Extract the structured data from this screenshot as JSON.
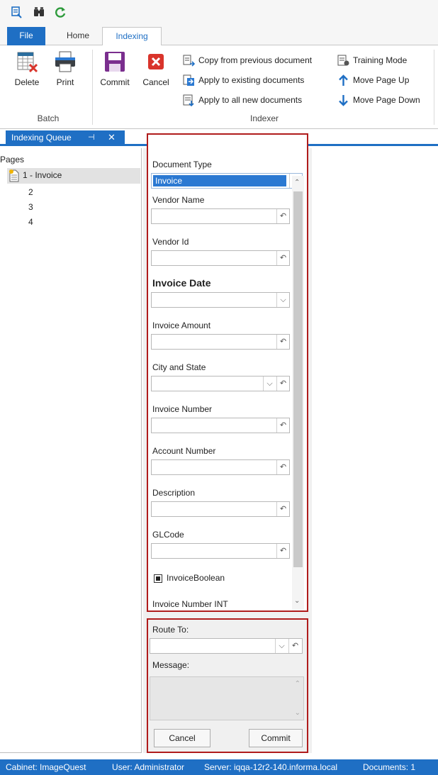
{
  "quick_access": {
    "icons": [
      "scan-icon",
      "binoculars-icon",
      "refresh-icon"
    ]
  },
  "tabs": {
    "file": "File",
    "home": "Home",
    "indexing": "Indexing"
  },
  "ribbon": {
    "batch": {
      "delete": "Delete",
      "print": "Print",
      "group_label": "Batch"
    },
    "indexer": {
      "commit": "Commit",
      "cancel": "Cancel",
      "copy_prev": "Copy from previous document",
      "apply_existing": "Apply to existing documents",
      "apply_new": "Apply to all new documents",
      "training_mode": "Training Mode",
      "move_up": "Move Page Up",
      "move_down": "Move Page Down",
      "group_label": "Indexer"
    }
  },
  "dock": {
    "tab_label": "Indexing Queue",
    "pin_glyph": "⊣",
    "close_glyph": "✕"
  },
  "pages": {
    "header": "Pages",
    "items": [
      "1 - Invoice",
      "2",
      "3",
      "4"
    ]
  },
  "index_form": {
    "document_type_label": "Document Type",
    "document_type_value": "Invoice",
    "fields": {
      "vendor_name": "Vendor Name",
      "vendor_id": "Vendor Id",
      "invoice_date": "Invoice Date",
      "invoice_amount": "Invoice Amount",
      "city_state": "City and State",
      "invoice_number": "Invoice Number",
      "account_number": "Account Number",
      "description": "Description",
      "glcode": "GLCode",
      "invoice_boolean": "InvoiceBoolean",
      "invoice_number_int": "Invoice Number INT"
    },
    "reset_glyph": "↶",
    "dropdown_glyph": "⌵"
  },
  "route": {
    "route_to_label": "Route To:",
    "message_label": "Message:",
    "cancel": "Cancel",
    "commit": "Commit"
  },
  "status": {
    "cabinet": "Cabinet: ImageQuest",
    "user": "User: Administrator",
    "server": "Server: iqqa-12r2-140.informa.local",
    "documents": "Documents: 1"
  },
  "colors": {
    "accent": "#1f6fc4",
    "highlight_border": "#b01c1c",
    "selection": "#2b79d2",
    "cancel_red": "#d9342b",
    "commit_purple": "#7a2e8e"
  }
}
